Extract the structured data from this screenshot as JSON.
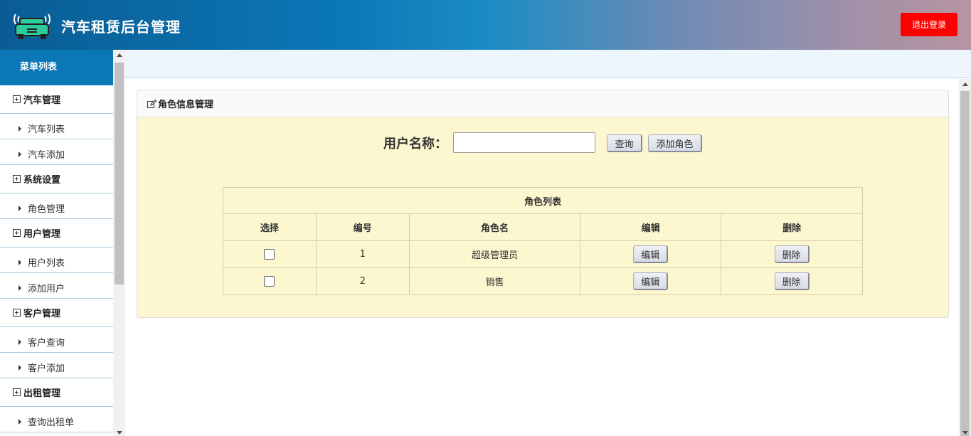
{
  "header": {
    "title": "汽车租赁后台管理",
    "logout_label": "退出登录",
    "logo_icon": "car-icon",
    "logout_color": "#ff0000"
  },
  "sidebar": {
    "title": "菜单列表",
    "groups": [
      {
        "label": "汽车管理",
        "items": [
          "汽车列表",
          "汽车添加"
        ]
      },
      {
        "label": "系统设置",
        "items": [
          "角色管理"
        ]
      },
      {
        "label": "用户管理",
        "items": [
          "用户列表",
          "添加用户"
        ]
      },
      {
        "label": "客户管理",
        "items": [
          "客户查询",
          "客户添加"
        ]
      },
      {
        "label": "出租管理",
        "items": [
          "查询出租单"
        ]
      }
    ]
  },
  "panel": {
    "title": "角色信息管理",
    "search": {
      "label": "用户名称：",
      "value": "",
      "query_label": "查询",
      "add_label": "添加角色"
    },
    "table": {
      "caption": "角色列表",
      "columns": [
        "选择",
        "编号",
        "角色名",
        "编辑",
        "删除"
      ],
      "rows": [
        {
          "id": "1",
          "name": "超级管理员",
          "edit": "编辑",
          "delete": "删除"
        },
        {
          "id": "2",
          "name": "销售",
          "edit": "编辑",
          "delete": "删除"
        }
      ]
    }
  },
  "colors": {
    "header_start": "#0a5d94",
    "sidebar_head": "#0b77b6",
    "panel_bg": "#fdf7d0"
  }
}
